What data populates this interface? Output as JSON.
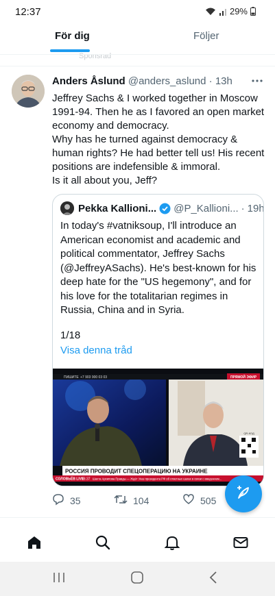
{
  "status_bar": {
    "time": "12:37",
    "battery": "29%"
  },
  "tabs": {
    "for_you": "För dig",
    "following": "Följer",
    "hidden_label": "Sponsrad"
  },
  "tweet": {
    "author_name": "Anders Åslund",
    "author_handle": "@anders_aslund",
    "separator": "·",
    "time": "13h",
    "text_lines": [
      "Jeffrey Sachs & I worked together in Moscow",
      "1991-94. Then he as I favored an open market",
      "economy and democracy.",
      "Why has he turned against democracy &",
      "human rights? He had better tell us! His recent",
      "positions are indefensible & immoral.",
      "Is it all about you, Jeff?"
    ],
    "quote": {
      "author_name": "Pekka Kallioni...",
      "author_handle": "@P_Kallioni...",
      "separator": "·",
      "time": "19h",
      "text": "In today's #vatniksoup, I'll introduce an American economist and academic and political commentator, Jeffrey Sachs (@JeffreyASachs). He's best-known for his deep hate for the \"US hegemony\", and for his love for the totalitarian regimes in Russia, China and in Syria.",
      "count": "1/18",
      "show_thread": "Visa denna tråd",
      "image": {
        "top_left": "ПИШИТЕ",
        "top_phone": "+7 903 900 03 03",
        "badge": "ПРЯМОЙ ЭФИР",
        "banner": "РОССИЯ ПРОВОДИТ СПЕЦОПЕРАЦИЮ НА УКРАИНЕ",
        "channel": "СОЛОВЬЁВ LIVE",
        "ticker_time": "16:37",
        "ticker_text": "Шахта Архипова Правды — Ждёт   Указ президента РФ об ответных шагах в связи с введением...",
        "qr_label": "QR-КОД"
      }
    },
    "actions": {
      "replies": "35",
      "retweets": "104",
      "likes": "505"
    }
  },
  "icons": {
    "more": "more-icon",
    "verified": "verified-badge-icon",
    "reply": "reply-icon",
    "retweet": "retweet-icon",
    "like": "heart-icon",
    "compose": "compose-feather-icon",
    "home": "home-icon",
    "search": "search-icon",
    "notifications": "bell-icon",
    "messages": "envelope-icon"
  },
  "colors": {
    "accent": "#1d9bf0",
    "text_primary": "#0f1419",
    "text_secondary": "#536471",
    "divider": "#eff3f4",
    "banner_red": "#c8102e"
  }
}
